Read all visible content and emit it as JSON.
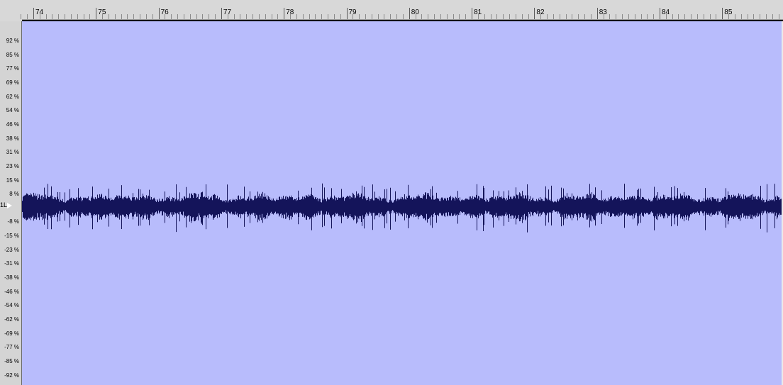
{
  "timeline": {
    "labels": [
      "74",
      "75",
      "76",
      "77",
      "78",
      "79",
      "80",
      "81",
      "82",
      "83",
      "84",
      "85"
    ]
  },
  "amplitude_scale": {
    "labels": [
      "92 %",
      "85 %",
      "77 %",
      "69 %",
      "62 %",
      "54 %",
      "46 %",
      "38 %",
      "31 %",
      "23 %",
      "15 %",
      "8 %",
      "-8 %",
      "-15 %",
      "-23 %",
      "-31 %",
      "-38 %",
      "-46 %",
      "-54 %",
      "-62 %",
      "-69 %",
      "-77 %",
      "-85 %",
      "-92 %"
    ]
  },
  "channel": {
    "label": "1L"
  },
  "colors": {
    "track_background": "#b8bcfc",
    "waveform": "#14145a",
    "ruler_background": "#d8d8d8"
  },
  "waveform": {
    "peak_amplitude_percent": 13,
    "typical_amplitude_percent": 8
  }
}
